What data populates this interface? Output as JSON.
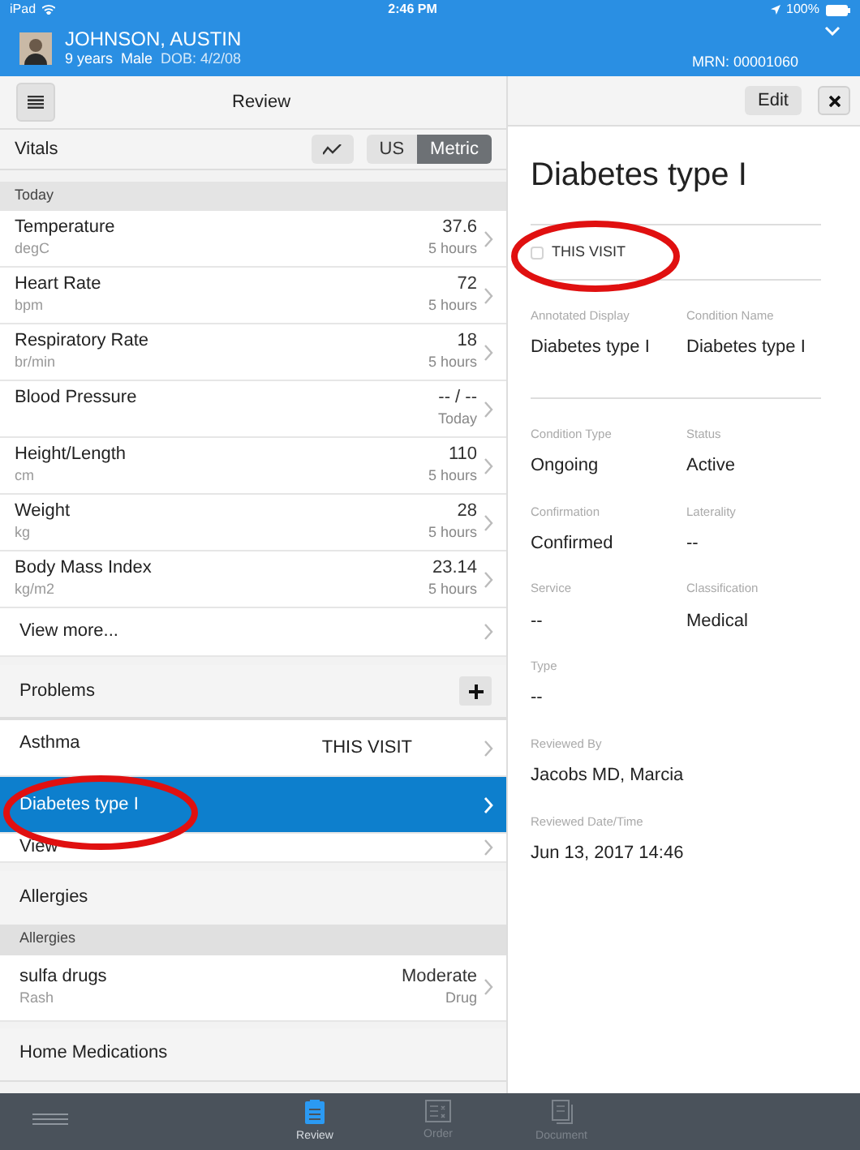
{
  "status_bar": {
    "device": "iPad",
    "time": "2:46 PM",
    "battery": "100%"
  },
  "patient": {
    "name": "JOHNSON, AUSTIN",
    "age": "9 years",
    "sex": "Male",
    "dob": "DOB: 4/2/08",
    "mrn": "MRN: 00001060"
  },
  "left_toolbar": {
    "title": "Review"
  },
  "vitals": {
    "title": "Vitals",
    "units": [
      {
        "label": "US",
        "selected": false
      },
      {
        "label": "Metric",
        "selected": true
      }
    ],
    "section": "Today",
    "rows": [
      {
        "name": "Temperature",
        "unit": "degC",
        "value": "37.6",
        "time": "5 hours"
      },
      {
        "name": "Heart Rate",
        "unit": "bpm",
        "value": "72",
        "time": "5 hours"
      },
      {
        "name": "Respiratory Rate",
        "unit": "br/min",
        "value": "18",
        "time": "5 hours"
      },
      {
        "name": "Blood Pressure",
        "value": "-- / --",
        "time": "Today"
      },
      {
        "name": "Height/Length",
        "unit": "cm",
        "value": "110",
        "time": "5 hours"
      },
      {
        "name": "Weight",
        "unit": "kg",
        "value": "28",
        "time": "5 hours"
      },
      {
        "name": "Body Mass Index",
        "unit": "kg/m2",
        "value": "23.14",
        "time": "5 hours"
      }
    ],
    "view_more": "View more..."
  },
  "problems": {
    "title": "Problems",
    "items": [
      {
        "name": "Asthma",
        "badge": "THIS VISIT",
        "selected": false
      },
      {
        "name": "Diabetes type I",
        "selected": true
      }
    ],
    "view_more": "View"
  },
  "allergies": {
    "title": "Allergies",
    "section": "Allergies",
    "rows": [
      {
        "name": "sulfa drugs",
        "reaction": "Rash",
        "severity": "Moderate",
        "type": "Drug"
      }
    ]
  },
  "home_medications": {
    "title": "Home Medications"
  },
  "detail": {
    "edit": "Edit",
    "title": "Diabetes type I",
    "this_visit": {
      "label": "THIS VISIT",
      "checked": false
    },
    "groups": [
      [
        [
          {
            "label": "Annotated Display",
            "value": "Diabetes type I"
          },
          {
            "label": "Condition Name",
            "value": "Diabetes type I"
          }
        ]
      ],
      [
        [
          {
            "label": "Condition Type",
            "value": "Ongoing"
          },
          {
            "label": "Status",
            "value": "Active"
          }
        ],
        [
          {
            "label": "Confirmation",
            "value": "Confirmed"
          },
          {
            "label": "Laterality",
            "value": "--"
          }
        ],
        [
          {
            "label": "Service",
            "value": "--"
          },
          {
            "label": "Classification",
            "value": "Medical"
          }
        ],
        [
          {
            "label": "Type",
            "value": "--"
          }
        ],
        [
          {
            "label": "Reviewed By",
            "value": "Jacobs MD, Marcia"
          }
        ],
        [
          {
            "label": "Reviewed Date/Time",
            "value": "Jun 13, 2017 14:46"
          }
        ]
      ]
    ]
  },
  "tab_bar": {
    "tabs": [
      {
        "label": "Review",
        "kind": "review",
        "selected": true
      },
      {
        "label": "Order",
        "kind": "order",
        "selected": false
      },
      {
        "label": "Document",
        "kind": "document",
        "selected": false
      }
    ]
  }
}
